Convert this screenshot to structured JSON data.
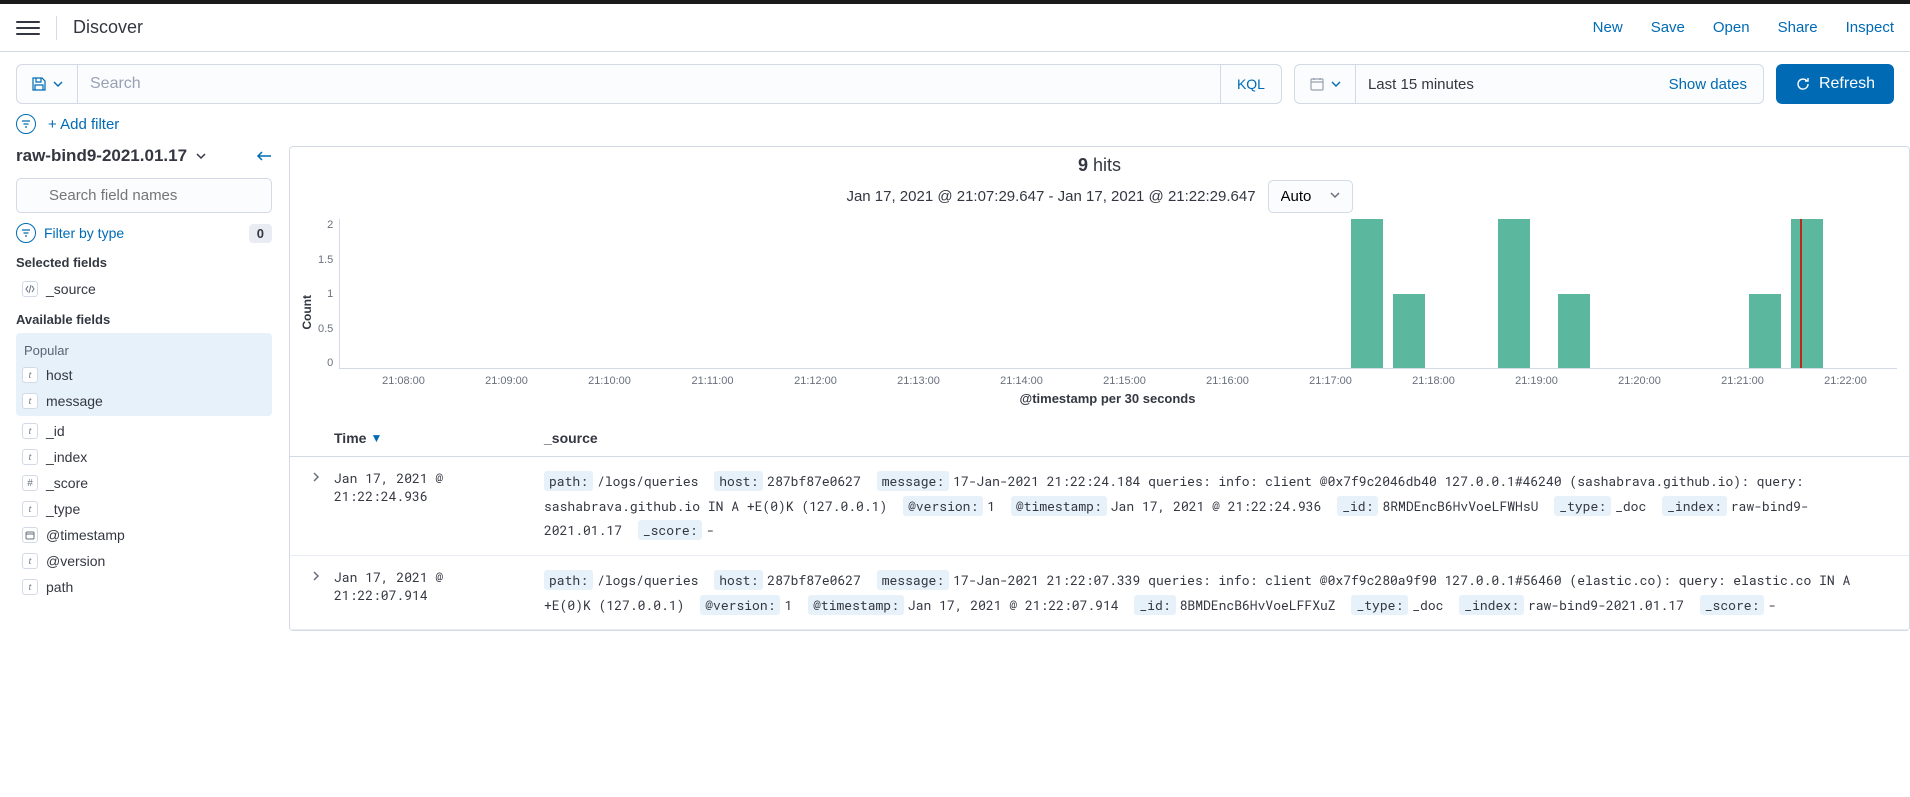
{
  "header": {
    "title": "Discover",
    "links": [
      "New",
      "Save",
      "Open",
      "Share",
      "Inspect"
    ]
  },
  "search": {
    "placeholder": "Search",
    "kql": "KQL"
  },
  "datepicker": {
    "label": "Last 15 minutes",
    "show_dates": "Show dates",
    "refresh": "Refresh"
  },
  "filter_bar": {
    "add_filter": "+ Add filter"
  },
  "sidebar": {
    "index_pattern": "raw-bind9-2021.01.17",
    "field_search_placeholder": "Search field names",
    "filter_by_type": "Filter by type",
    "filter_count": "0",
    "selected_label": "Selected fields",
    "selected": [
      {
        "type": "src",
        "name": "_source"
      }
    ],
    "available_label": "Available fields",
    "popular_label": "Popular",
    "popular": [
      {
        "type": "t",
        "name": "host"
      },
      {
        "type": "t",
        "name": "message"
      }
    ],
    "available": [
      {
        "type": "t",
        "name": "_id"
      },
      {
        "type": "t",
        "name": "_index"
      },
      {
        "type": "#",
        "name": "_score"
      },
      {
        "type": "t",
        "name": "_type"
      },
      {
        "type": "date",
        "name": "@timestamp"
      },
      {
        "type": "t",
        "name": "@version"
      },
      {
        "type": "t",
        "name": "path"
      }
    ]
  },
  "hits": {
    "count": "9",
    "suffix": "hits",
    "time_range": "Jan 17, 2021 @ 21:07:29.647 - Jan 17, 2021 @ 21:22:29.647",
    "interval": "Auto",
    "y_label": "Count",
    "x_label": "@timestamp per 30 seconds"
  },
  "chart_data": {
    "type": "bar",
    "title": "9 hits",
    "xlabel": "@timestamp per 30 seconds",
    "ylabel": "Count",
    "ylim": [
      0,
      2
    ],
    "y_ticks": [
      "2",
      "1.5",
      "1",
      "0.5",
      "0"
    ],
    "x_ticks": [
      "21:08:00",
      "21:09:00",
      "21:10:00",
      "21:11:00",
      "21:12:00",
      "21:13:00",
      "21:14:00",
      "21:15:00",
      "21:16:00",
      "21:17:00",
      "21:18:00",
      "21:19:00",
      "21:20:00",
      "21:21:00",
      "21:22:00"
    ],
    "bars": [
      {
        "x_pct": 64.9,
        "value": 2
      },
      {
        "x_pct": 67.6,
        "value": 1
      },
      {
        "x_pct": 74.4,
        "value": 2
      },
      {
        "x_pct": 78.2,
        "value": 1
      },
      {
        "x_pct": 90.5,
        "value": 1
      },
      {
        "x_pct": 93.2,
        "value": 2
      }
    ],
    "marker_x_pct": 93.8
  },
  "table": {
    "col_time": "Time",
    "col_source": "_source",
    "rows": [
      {
        "time": "Jan 17, 2021 @ 21:22:24.936",
        "fields": [
          {
            "k": "path:",
            "v": "/logs/queries"
          },
          {
            "k": "host:",
            "v": "287bf87e0627"
          },
          {
            "k": "message:",
            "v": "17-Jan-2021 21:22:24.184 queries: info: client @0x7f9c2046db40 127.0.0.1#46240 (sashabrava.github.io): query: sashabrava.github.io IN A +E(0)K (127.0.0.1)"
          },
          {
            "k": "@version:",
            "v": "1"
          },
          {
            "k": "@timestamp:",
            "v": "Jan 17, 2021 @ 21:22:24.936"
          },
          {
            "k": "_id:",
            "v": "8RMDEncB6HvVoeLFWHsU"
          },
          {
            "k": "_type:",
            "v": "_doc"
          },
          {
            "k": "_index:",
            "v": "raw-bind9-2021.01.17"
          },
          {
            "k": "_score:",
            "v": "-"
          }
        ]
      },
      {
        "time": "Jan 17, 2021 @ 21:22:07.914",
        "fields": [
          {
            "k": "path:",
            "v": "/logs/queries"
          },
          {
            "k": "host:",
            "v": "287bf87e0627"
          },
          {
            "k": "message:",
            "v": "17-Jan-2021 21:22:07.339 queries: info: client @0x7f9c280a9f90 127.0.0.1#56460 (elastic.co): query: elastic.co IN A +E(0)K (127.0.0.1)"
          },
          {
            "k": "@version:",
            "v": "1"
          },
          {
            "k": "@timestamp:",
            "v": "Jan 17, 2021 @ 21:22:07.914"
          },
          {
            "k": "_id:",
            "v": "8BMDEncB6HvVoeLFFXuZ"
          },
          {
            "k": "_type:",
            "v": "_doc"
          },
          {
            "k": "_index:",
            "v": "raw-bind9-2021.01.17"
          },
          {
            "k": "_score:",
            "v": "-"
          }
        ]
      }
    ]
  }
}
